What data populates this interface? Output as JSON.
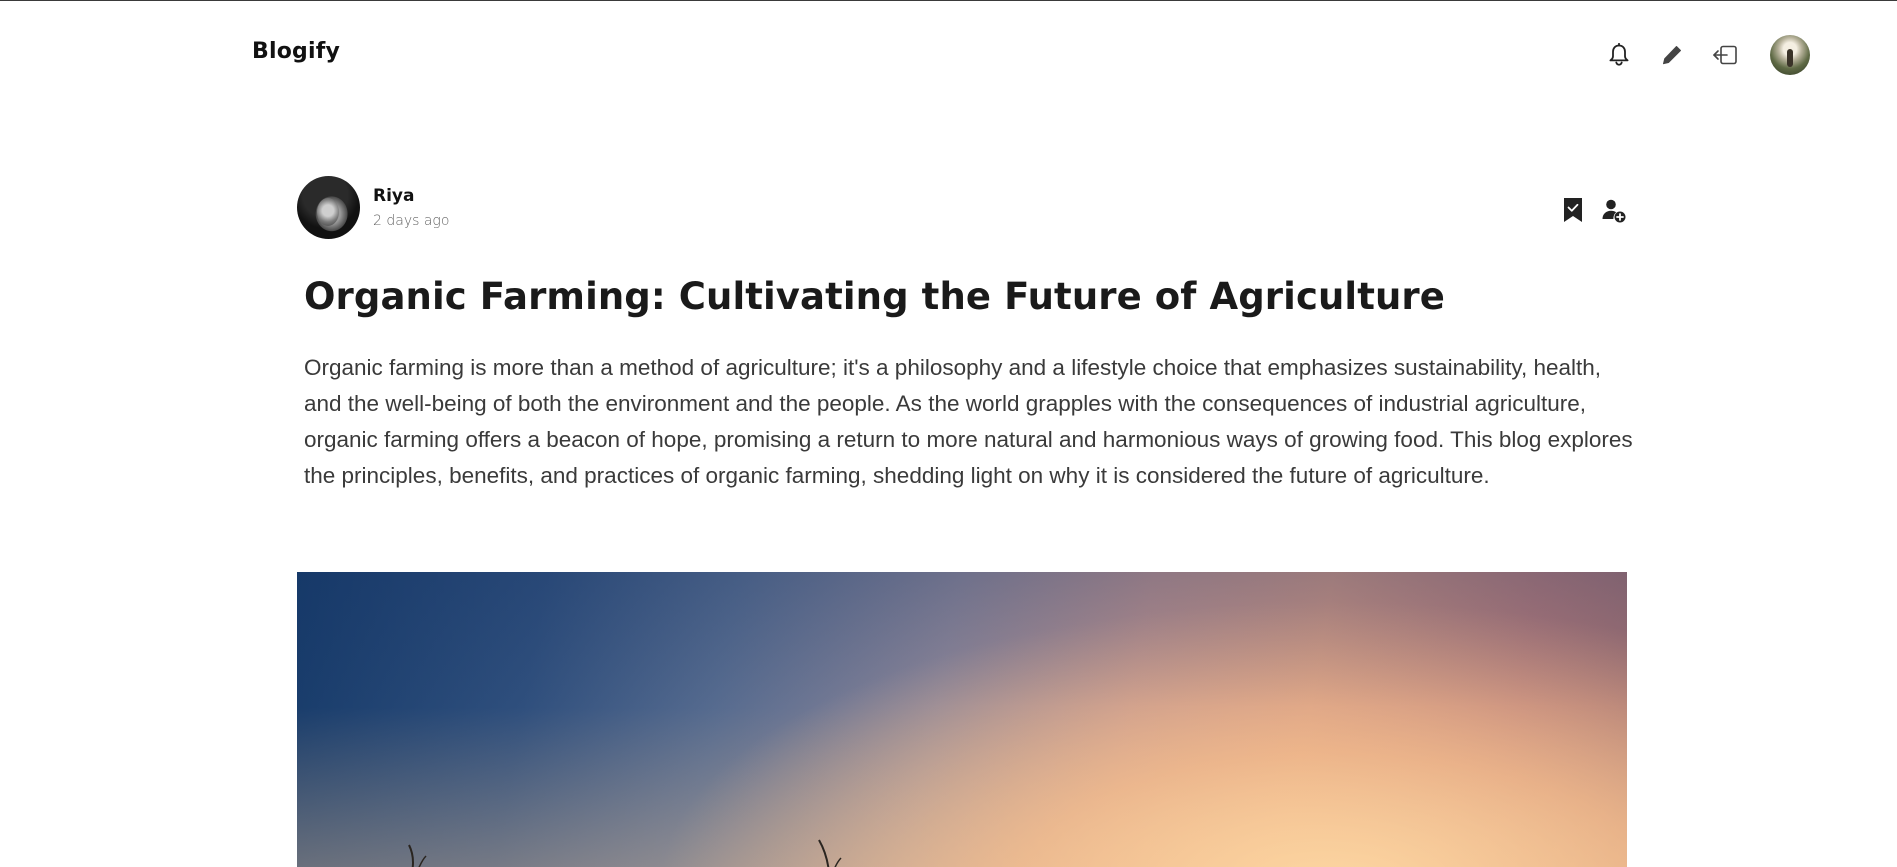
{
  "header": {
    "brand": "Blogify",
    "icons": {
      "notifications": "bell-icon",
      "write": "pencil-icon",
      "logout": "logout-icon",
      "profile": "avatar"
    }
  },
  "article": {
    "author": {
      "name": "Riya",
      "posted": "2 days ago"
    },
    "actions": {
      "bookmark": "bookmark-icon",
      "follow": "follow-user-icon"
    },
    "title": "Organic Farming: Cultivating the Future of Agriculture",
    "intro": "Organic farming is more than a method of agriculture; it's a philosophy and a lifestyle choice that emphasizes sustainability, health, and the well-being of both the environment and the people. As the world grapples with the consequences of industrial agriculture, organic farming offers a beacon of hope, promising a return to more natural and harmonious ways of growing food. This blog explores the principles, benefits, and practices of organic farming, shedding light on why it is considered the future of agriculture.",
    "cover_image": "sunset-field-photo"
  },
  "colors": {
    "text": "#1a1a1a",
    "body_text": "#3a3a3a",
    "muted": "#666666",
    "background": "#ffffff"
  }
}
